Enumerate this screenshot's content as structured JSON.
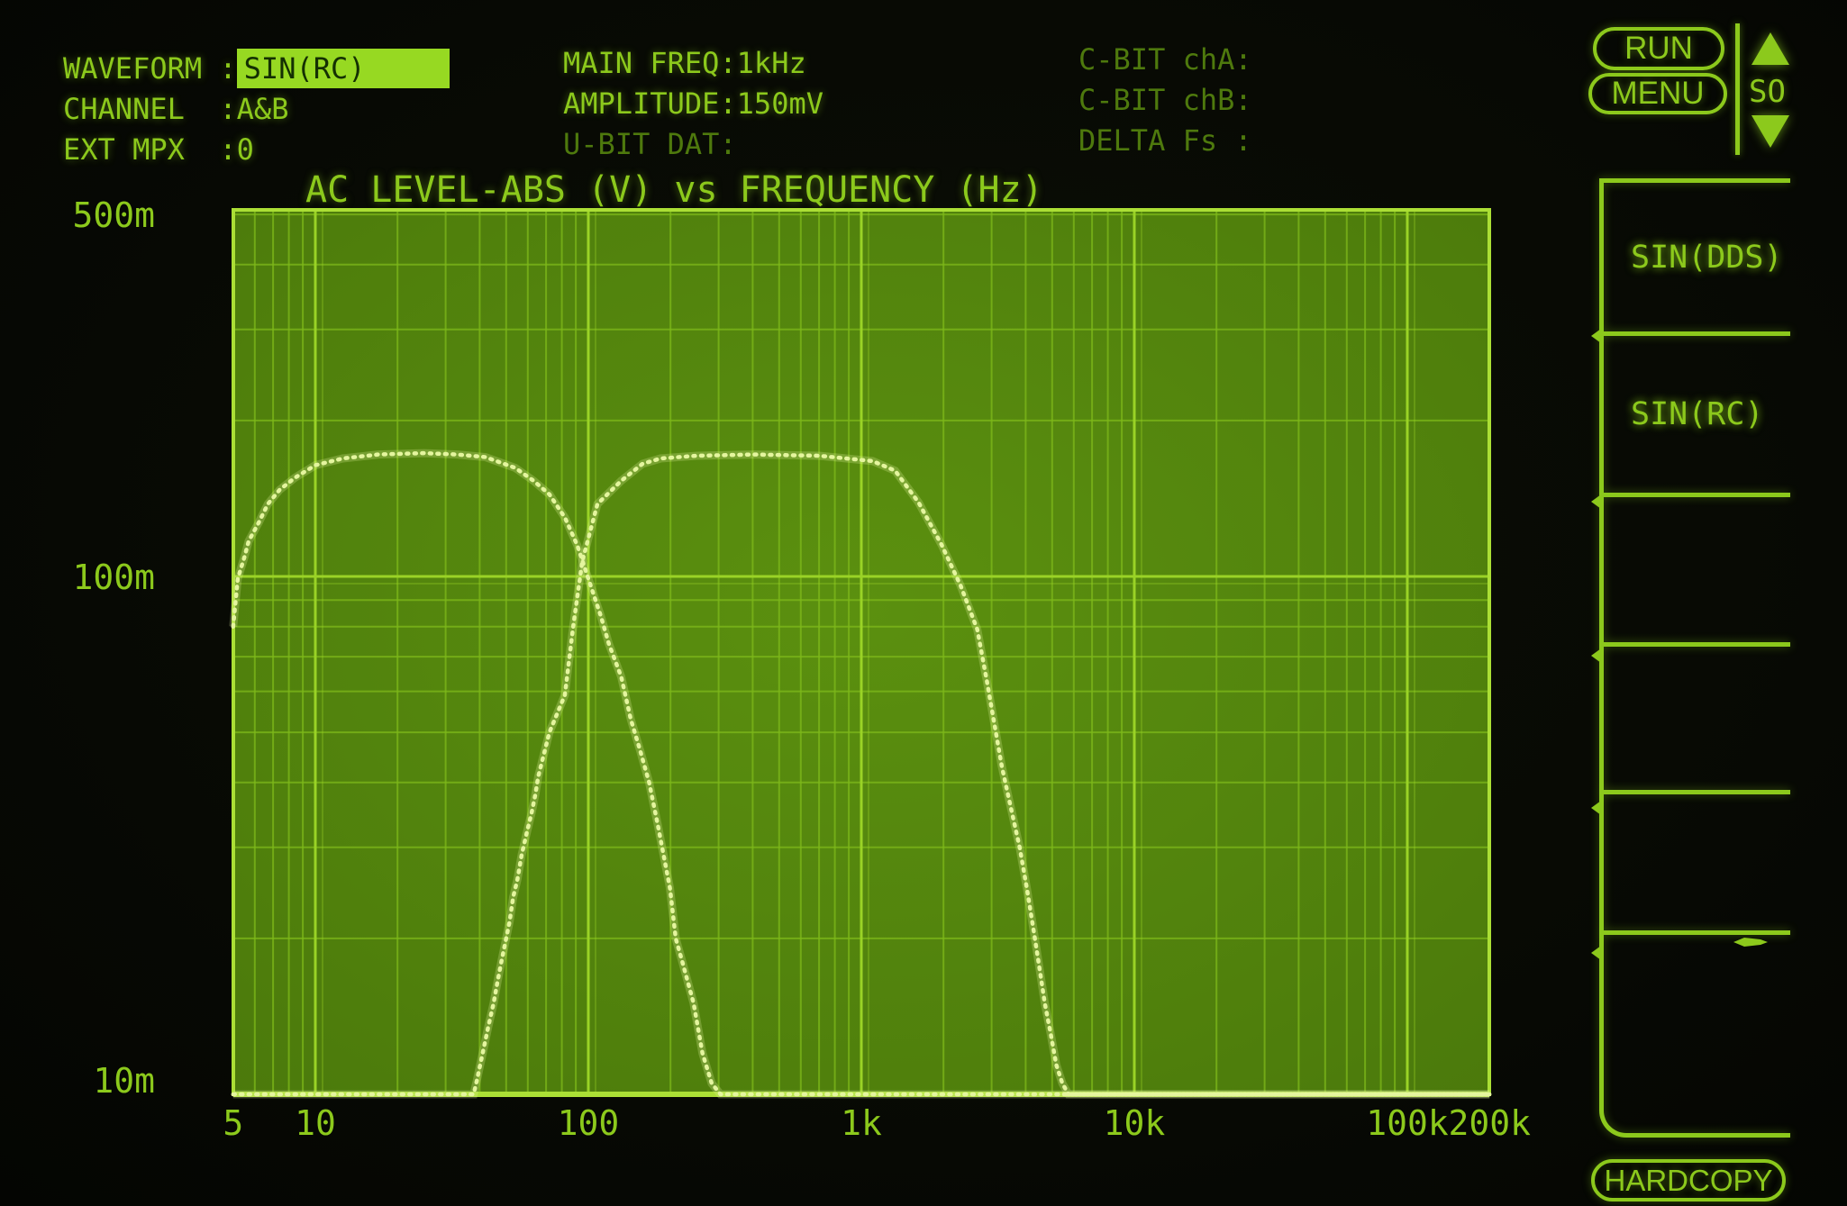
{
  "header": {
    "left": [
      {
        "label": "WAVEFORM :",
        "value": "SIN(RC)",
        "highlight": true,
        "dim": false
      },
      {
        "label": "CHANNEL  :",
        "value": "A&B",
        "highlight": false,
        "dim": false
      },
      {
        "label": "EXT MPX  :",
        "value": "0",
        "highlight": false,
        "dim": false
      }
    ],
    "middle": [
      {
        "label": "MAIN FREQ:",
        "value": "1kHz",
        "highlight": false,
        "dim": false
      },
      {
        "label": "AMPLITUDE:",
        "value": "150mV",
        "highlight": false,
        "dim": false
      },
      {
        "label": "U-BIT DAT:",
        "value": "",
        "highlight": false,
        "dim": true
      }
    ],
    "right": [
      {
        "label": "C-BIT chA:",
        "value": "",
        "highlight": false,
        "dim": true
      },
      {
        "label": "C-BIT chB:",
        "value": "",
        "highlight": false,
        "dim": true
      },
      {
        "label": "DELTA Fs :",
        "value": "",
        "highlight": false,
        "dim": true
      }
    ]
  },
  "controls": {
    "run": "RUN",
    "menu": "MENU",
    "scroll_label": "SO",
    "hardcopy": "HARDCOPY"
  },
  "softkeys": [
    {
      "label": "SIN(DDS)"
    },
    {
      "label": "SIN(RC)"
    },
    {
      "label": ""
    },
    {
      "label": ""
    },
    {
      "label": ""
    },
    {
      "label": ""
    }
  ],
  "chart_data": {
    "type": "line",
    "title": "AC LEVEL-ABS (V) vs FREQUENCY (Hz)",
    "xlabel": "FREQUENCY (Hz)",
    "ylabel": "AC LEVEL-ABS (V)",
    "grid": true,
    "x_axis": {
      "scale": "log",
      "min_hz": 5,
      "max_hz": 200000,
      "major_hz": [
        10,
        100,
        1000,
        10000,
        100000
      ],
      "tick_labels": [
        {
          "hz": 5,
          "label": "5"
        },
        {
          "hz": 10,
          "label": "10"
        },
        {
          "hz": 100,
          "label": "100"
        },
        {
          "hz": 1000,
          "label": "1k"
        },
        {
          "hz": 10000,
          "label": "10k"
        },
        {
          "hz": 100000,
          "label": "100k"
        },
        {
          "hz": 200000,
          "label": "200k"
        }
      ]
    },
    "y_axis": {
      "scale": "log",
      "unit": "V",
      "min_mv": 10,
      "max_mv": 500,
      "major_mv": [
        100
      ],
      "minor_mv": [
        20,
        30,
        40,
        50,
        60,
        70,
        80,
        90,
        200,
        300,
        400,
        500
      ],
      "tick_labels": [
        {
          "mv": 500,
          "label": "500m"
        },
        {
          "mv": 100,
          "label": "100m"
        },
        {
          "mv": 10,
          "label": "10m"
        }
      ]
    },
    "series": [
      {
        "name": "trace-A-low-band",
        "points_hz_mv": [
          [
            5,
            80
          ],
          [
            5.2,
            99
          ],
          [
            5.5,
            109
          ],
          [
            5.7,
            117
          ],
          [
            6.2,
            127
          ],
          [
            6.7,
            138
          ],
          [
            7.4,
            147
          ],
          [
            8.4,
            155
          ],
          [
            10,
            164
          ],
          [
            12.6,
            169
          ],
          [
            17,
            172
          ],
          [
            25,
            173
          ],
          [
            33,
            172
          ],
          [
            42,
            170
          ],
          [
            54,
            162
          ],
          [
            63,
            153
          ],
          [
            72,
            144
          ],
          [
            82,
            130
          ],
          [
            91,
            115
          ],
          [
            100,
            99
          ],
          [
            111,
            84
          ],
          [
            119,
            74
          ],
          [
            132,
            64
          ],
          [
            143,
            53
          ],
          [
            155,
            46
          ],
          [
            167,
            40
          ],
          [
            180,
            33
          ],
          [
            199,
            25
          ],
          [
            209,
            20
          ],
          [
            221,
            18
          ],
          [
            243,
            15
          ],
          [
            262,
            12
          ],
          [
            283,
            10.5
          ],
          [
            305,
            10
          ],
          [
            200000,
            10
          ]
        ]
      },
      {
        "name": "trace-B-wide-band",
        "points_hz_mv": [
          [
            5,
            10
          ],
          [
            38,
            10
          ],
          [
            39,
            10.6
          ],
          [
            41,
            12
          ],
          [
            43,
            13.5
          ],
          [
            45,
            15
          ],
          [
            46.5,
            16.5
          ],
          [
            48,
            18
          ],
          [
            50,
            20
          ],
          [
            51.5,
            21.6
          ],
          [
            53,
            24
          ],
          [
            55,
            26
          ],
          [
            57,
            29
          ],
          [
            59.5,
            32
          ],
          [
            62,
            35
          ],
          [
            64,
            38
          ],
          [
            65.5,
            41
          ],
          [
            72,
            50
          ],
          [
            82,
            59
          ],
          [
            88,
            80
          ],
          [
            95,
            107
          ],
          [
            108,
            138
          ],
          [
            132,
            153
          ],
          [
            158,
            165
          ],
          [
            184,
            169
          ],
          [
            250,
            171
          ],
          [
            400,
            172
          ],
          [
            700,
            171
          ],
          [
            1100,
            167
          ],
          [
            1330,
            160
          ],
          [
            1620,
            139
          ],
          [
            1970,
            115
          ],
          [
            2310,
            96
          ],
          [
            2660,
            79
          ],
          [
            2880,
            63
          ],
          [
            3270,
            43
          ],
          [
            3480,
            37
          ],
          [
            3800,
            30
          ],
          [
            4040,
            25
          ],
          [
            4260,
            21
          ],
          [
            4460,
            18
          ],
          [
            4700,
            15
          ],
          [
            4950,
            13
          ],
          [
            5180,
            11.4
          ],
          [
            5450,
            10.5
          ],
          [
            5740,
            10
          ],
          [
            200000,
            10
          ]
        ]
      }
    ]
  },
  "colors": {
    "text_bright": "#8cc91c",
    "text_dim": "#4e790d",
    "highlight_bg": "#97d922",
    "highlight_text": "#143003",
    "plot_bg": "#5b900f",
    "plot_bg_edge": "#4a780b",
    "grid_minor": "#7eb91a",
    "grid_major": "#9ad326",
    "plot_border": "#abdf35",
    "trace": "#e4f59e"
  }
}
